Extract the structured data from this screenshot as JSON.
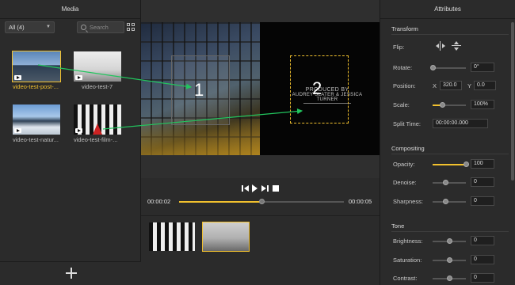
{
  "media_panel": {
    "title": "Media",
    "filter_value": "All (4)",
    "search_placeholder": "Search",
    "items": [
      {
        "label": "video-test-post-...",
        "selected": true
      },
      {
        "label": "video-test-7",
        "selected": false
      },
      {
        "label": "video-test-natur...",
        "selected": false
      },
      {
        "label": "video-test-film-...",
        "selected": false
      }
    ]
  },
  "preview": {
    "region1_number": "1",
    "region2_number": "2",
    "credit_line1": "PRODUCED BY",
    "credit_line2": "AUDREY SLATER & JESSICA TURNER"
  },
  "playback": {
    "current_time": "00:00:02",
    "total_time": "00:00:05",
    "progress": 0.5
  },
  "attributes": {
    "title": "Attributes",
    "transform": {
      "section": "Transform",
      "flip_label": "Flip:",
      "rotate_label": "Rotate:",
      "rotate_value": "0°",
      "position_label": "Position:",
      "x_label": "X",
      "x_value": "320.0",
      "y_label": "Y",
      "y_value": "0.0",
      "scale_label": "Scale:",
      "scale_value": "100%",
      "split_label": "Split Time:",
      "split_value": "00:00:00.000"
    },
    "compositing": {
      "section": "Compositing",
      "opacity_label": "Opacity:",
      "opacity_value": "100",
      "denoise_label": "Denoise:",
      "denoise_value": "0",
      "sharpness_label": "Sharpness:",
      "sharpness_value": "0"
    },
    "tone": {
      "section": "Tone",
      "brightness_label": "Brightness:",
      "brightness_value": "0",
      "saturation_label": "Saturation:",
      "saturation_value": "0",
      "contrast_label": "Contrast:",
      "contrast_value": "0"
    }
  },
  "colors": {
    "accent": "#f2c12e",
    "arrow": "#22c55e",
    "panel_bg": "#2b2b2b"
  }
}
